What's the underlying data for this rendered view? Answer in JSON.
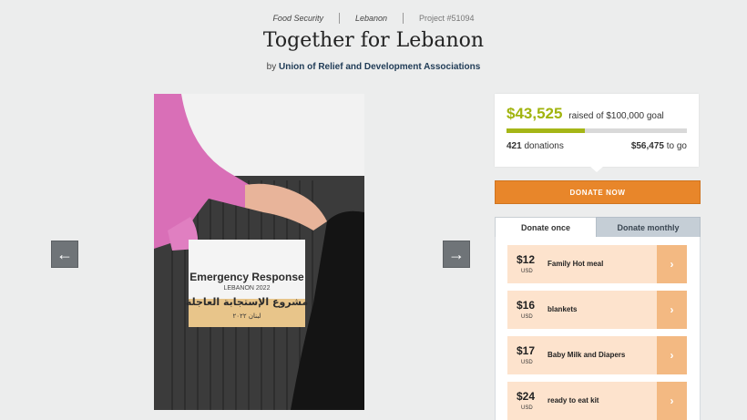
{
  "breadcrumb": {
    "category": "Food Security",
    "location": "Lebanon",
    "project": "Project #51094"
  },
  "title": "Together for Lebanon",
  "byline": {
    "prefix": "by",
    "organization": "Union of Relief and Development Associations"
  },
  "photo": {
    "sign_title": "Emergency Response",
    "sign_subtitle": "LEBANON 2022",
    "sign_arabic": "مشروع الإستجابة العاجلة",
    "sign_arabic_sub": "لبنان ٢٠٢٢"
  },
  "carousel": {
    "prev_icon": "arrow-left-icon",
    "next_icon": "arrow-right-icon",
    "prev_glyph": "←",
    "next_glyph": "→"
  },
  "funding": {
    "raised": "$43,525",
    "goal_text": "raised of $100,000 goal",
    "donations_count": "421",
    "donations_label": "donations",
    "to_go_amount": "$56,475",
    "to_go_label": "to go",
    "progress_fraction": 0.435
  },
  "donate_button": "DONATE NOW",
  "tabs": {
    "once": "Donate once",
    "monthly": "Donate monthly"
  },
  "options": [
    {
      "price": "$12",
      "currency": "USD",
      "label": "Family Hot meal"
    },
    {
      "price": "$16",
      "currency": "USD",
      "label": "blankets"
    },
    {
      "price": "$17",
      "currency": "USD",
      "label": "Baby Milk and Diapers"
    },
    {
      "price": "$24",
      "currency": "USD",
      "label": "ready to eat kit"
    }
  ],
  "option_arrow": "›",
  "colors": {
    "accent_green": "#a1b40e",
    "donate_orange": "#e8862a",
    "option_bg": "#fde3cd",
    "option_arrow_bg": "#f3b982"
  }
}
